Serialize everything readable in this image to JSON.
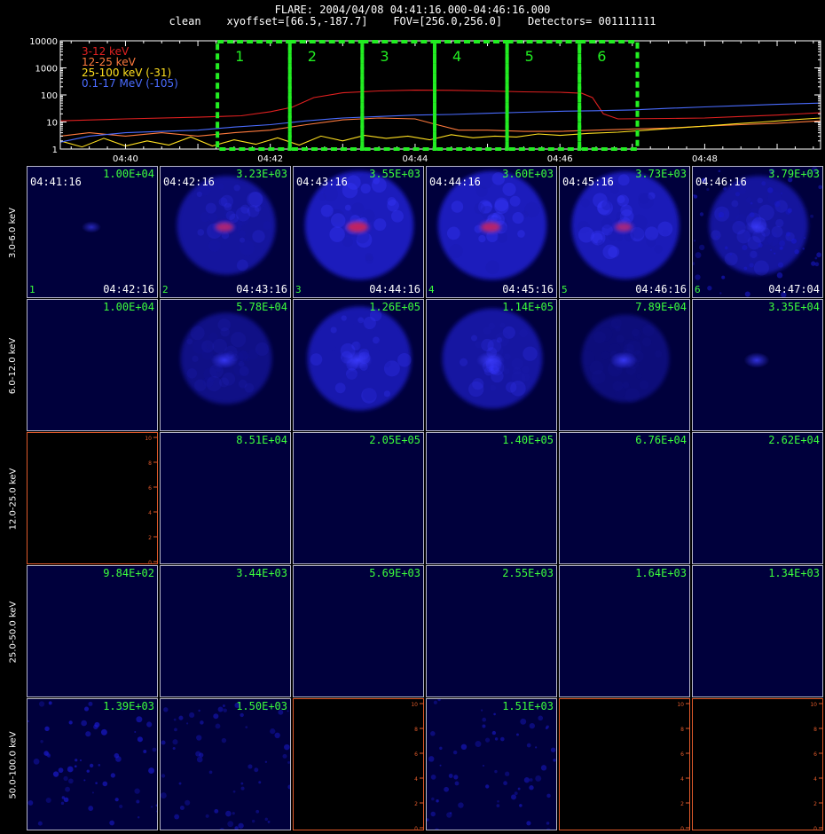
{
  "header": {
    "title": "FLARE: 2004/04/08 04:41:16.000-04:46:16.000",
    "subtitle": "clean    xyoffset=[66.5,-187.7]    FOV=[256.0,256.0]    Detectors= 001111111"
  },
  "chart_data": [
    {
      "type": "line",
      "x_unit": "minutes",
      "x_ticks": [
        {
          "value": 40,
          "label": "04:40"
        },
        {
          "value": 42,
          "label": "04:42"
        },
        {
          "value": 44,
          "label": "04:44"
        },
        {
          "value": 46,
          "label": "04:46"
        },
        {
          "value": 48,
          "label": "04:48"
        }
      ],
      "xlim": [
        39.1,
        49.6
      ],
      "yscale": "log",
      "ylim": [
        1,
        10000
      ],
      "y_ticks": [
        {
          "value": 1,
          "label": "1"
        },
        {
          "value": 10,
          "label": "10"
        },
        {
          "value": 100,
          "label": "100"
        },
        {
          "value": 1000,
          "label": "1000"
        },
        {
          "value": 10000,
          "label": "10000"
        }
      ],
      "legend_placement": "top-left",
      "series": [
        {
          "name": "3-12 keV",
          "color": "#e02020",
          "x": [
            39.1,
            40,
            41,
            41.6,
            42,
            42.3,
            42.6,
            43,
            43.5,
            44,
            44.5,
            45,
            45.5,
            46,
            46.3,
            46.45,
            46.6,
            46.8,
            47.5,
            48,
            48.5,
            49,
            49.6
          ],
          "y": [
            11,
            13,
            15,
            17,
            24,
            35,
            80,
            120,
            140,
            150,
            148,
            140,
            130,
            125,
            115,
            80,
            20,
            13,
            13.5,
            14,
            16,
            18,
            22
          ]
        },
        {
          "name": "12-25 keV",
          "color": "#ff7a3d",
          "x": [
            39.1,
            39.5,
            40,
            40.5,
            41,
            41.5,
            42,
            42.5,
            43,
            43.5,
            44,
            44.3,
            44.6,
            45,
            45.5,
            46,
            46.5,
            47,
            47.5,
            48,
            48.5,
            49,
            49.6
          ],
          "y": [
            3,
            4,
            3,
            4,
            3,
            4,
            5,
            8,
            12,
            14,
            13,
            8,
            5,
            5,
            4.5,
            4.5,
            5,
            5.5,
            6,
            7,
            8,
            9,
            11
          ]
        },
        {
          "name": "25-100 keV (-31)",
          "color": "#ffe020",
          "x": [
            39.1,
            39.4,
            39.7,
            40,
            40.3,
            40.6,
            40.9,
            41.2,
            41.5,
            41.8,
            42.1,
            42.4,
            42.7,
            43,
            43.3,
            43.6,
            43.9,
            44.2,
            44.5,
            44.8,
            45.1,
            45.4,
            45.7,
            46,
            46.4,
            46.8,
            47.2,
            47.6,
            48,
            48.4,
            48.8,
            49.2,
            49.6
          ],
          "y": [
            2,
            1.2,
            2.5,
            1.3,
            2,
            1.4,
            2.8,
            1.3,
            2.2,
            1.5,
            2.6,
            1.4,
            3,
            2,
            3.2,
            2.5,
            3,
            2.2,
            3.4,
            2.6,
            3,
            2.8,
            3.6,
            3.2,
            3.8,
            4.2,
            5,
            6,
            7,
            8.5,
            10,
            12,
            14
          ]
        },
        {
          "name": "0.1-17 MeV (-105)",
          "color": "#4a6cff",
          "x": [
            39.1,
            39.5,
            40,
            40.5,
            41,
            41.5,
            42,
            42.5,
            43,
            43.5,
            44,
            44.5,
            45,
            45.5,
            46,
            46.5,
            47,
            47.5,
            48,
            48.5,
            49,
            49.6
          ],
          "y": [
            1.8,
            3,
            4,
            4.5,
            5,
            6.5,
            8,
            11,
            14,
            16,
            18,
            19,
            21,
            23,
            25,
            26,
            28,
            32,
            36,
            40,
            45,
            50
          ]
        }
      ],
      "intervals": [
        {
          "label": "1",
          "start": 41.27,
          "end": 42.27
        },
        {
          "label": "2",
          "start": 42.27,
          "end": 43.27
        },
        {
          "label": "3",
          "start": 43.27,
          "end": 44.27
        },
        {
          "label": "4",
          "start": 44.27,
          "end": 45.27
        },
        {
          "label": "5",
          "start": 45.27,
          "end": 46.27
        },
        {
          "label": "6",
          "start": 46.27,
          "end": 47.07
        }
      ],
      "interval_color": "#22ee22"
    },
    {
      "type": "heatmap",
      "colormap": [
        "#00003c",
        "#1010c8",
        "#3c3cff",
        "#c02060"
      ],
      "energy_bands": [
        "3.0-6.0 keV",
        "6.0-12.0 keV",
        "12.0-25.0 keV",
        "25.0-50.0 keV",
        "50.0-100.0 keV"
      ],
      "time_windows": [
        {
          "index": "1",
          "start": "04:41:16",
          "end": "04:42:16"
        },
        {
          "index": "2",
          "start": "04:42:16",
          "end": "04:43:16"
        },
        {
          "index": "3",
          "start": "04:43:16",
          "end": "04:44:16"
        },
        {
          "index": "4",
          "start": "04:44:16",
          "end": "04:45:16"
        },
        {
          "index": "5",
          "start": "04:45:16",
          "end": "04:46:16"
        },
        {
          "index": "6",
          "start": "04:46:16",
          "end": "04:47:04"
        }
      ],
      "max_values": [
        [
          "1.00E+04",
          "3.23E+03",
          "3.55E+03",
          "3.60E+03",
          "3.73E+03",
          "3.79E+03"
        ],
        [
          "1.00E+04",
          "5.78E+04",
          "1.26E+05",
          "1.14E+05",
          "7.89E+04",
          "3.35E+04"
        ],
        [
          "",
          "8.51E+04",
          "2.05E+05",
          "1.40E+05",
          "6.76E+04",
          "2.62E+04"
        ],
        [
          "9.84E+02",
          "3.44E+03",
          "5.69E+03",
          "2.55E+03",
          "1.64E+03",
          "1.34E+03"
        ],
        [
          "1.39E+03",
          "1.50E+03",
          "",
          "1.51E+03",
          "",
          ""
        ]
      ],
      "blank_cells": [
        [
          2,
          0
        ],
        [
          4,
          2
        ],
        [
          4,
          4
        ],
        [
          4,
          5
        ]
      ],
      "blank_axis_ticks": [
        "0",
        "2",
        "4",
        "6",
        "8",
        "10"
      ],
      "source_ring": [
        [
          0.0,
          0.55,
          0.95,
          0.95,
          0.9,
          0.55
        ],
        [
          0.0,
          0.25,
          0.75,
          0.6,
          0.1,
          0.0
        ],
        [
          0.0,
          0.0,
          0.0,
          0.0,
          0.0,
          0.0
        ],
        [
          0.0,
          0.0,
          0.0,
          0.0,
          0.0,
          0.0
        ],
        [
          0.0,
          0.0,
          0.0,
          0.0,
          0.0,
          0.0
        ]
      ],
      "source_core": [
        [
          0.12,
          0.55,
          0.85,
          0.8,
          0.6,
          0.45
        ],
        [
          0.0,
          0.65,
          0.85,
          0.75,
          0.7,
          0.55
        ],
        [
          0.0,
          0.0,
          0.0,
          0.0,
          0.0,
          0.0
        ],
        [
          0.0,
          0.0,
          0.0,
          0.0,
          0.0,
          0.0
        ],
        [
          0.0,
          0.0,
          0.0,
          0.0,
          0.0,
          0.0
        ]
      ],
      "red_core": [
        [
          0.0,
          0.7,
          1.0,
          0.85,
          0.6,
          0.0
        ],
        [
          0.0,
          0.0,
          0.0,
          0.0,
          0.0,
          0.0
        ],
        [
          0.0,
          0.0,
          0.0,
          0.0,
          0.0,
          0.0
        ],
        [
          0.0,
          0.0,
          0.0,
          0.0,
          0.0,
          0.0
        ],
        [
          0.0,
          0.0,
          0.0,
          0.0,
          0.0,
          0.0
        ]
      ],
      "noise": [
        [
          0.0,
          0.0,
          0.0,
          0.0,
          0.0,
          0.6
        ],
        [
          0.0,
          0.0,
          0.0,
          0.0,
          0.0,
          0.0
        ],
        [
          0.0,
          0.0,
          0.0,
          0.0,
          0.0,
          0.0
        ],
        [
          0.0,
          0.0,
          0.0,
          0.0,
          0.0,
          0.0
        ],
        [
          0.8,
          0.5,
          0.0,
          0.6,
          0.0,
          0.0
        ]
      ]
    }
  ]
}
